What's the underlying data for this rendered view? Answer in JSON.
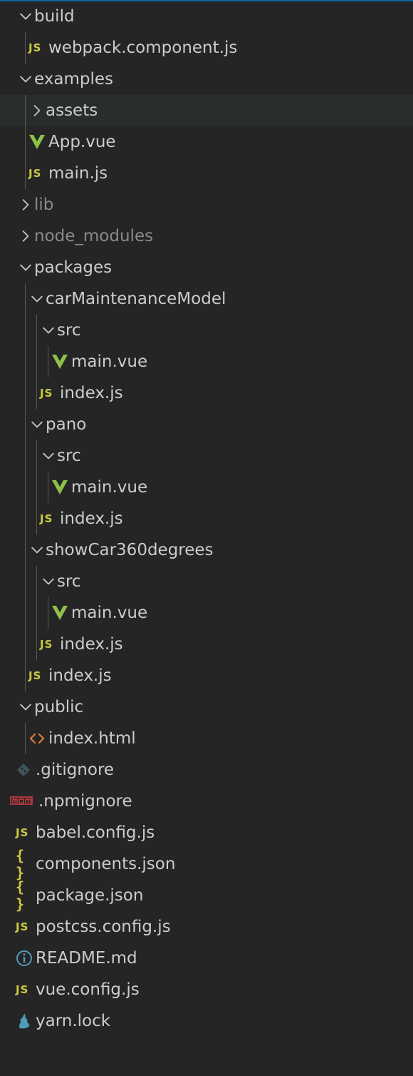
{
  "theme": {
    "background": "#252526",
    "hover_row": "#2a2d2e",
    "text": "#cccccc",
    "dim_text": "#8b8b8b",
    "js_color": "#cbcb41",
    "vue_color": "#8dc149",
    "html_color": "#e37933",
    "git_color": "#41535b",
    "npm_color": "#cc3e44",
    "info_color": "#519aba",
    "yarn_color": "#519aba",
    "indent_guide": "#585858"
  },
  "tree": [
    {
      "label": "build",
      "kind": "folder",
      "expanded": true,
      "depth": 0
    },
    {
      "label": "webpack.component.js",
      "kind": "file",
      "icon": "js-icon",
      "depth": 1
    },
    {
      "label": "examples",
      "kind": "folder",
      "expanded": true,
      "depth": 0
    },
    {
      "label": "assets",
      "kind": "folder",
      "expanded": false,
      "depth": 1,
      "hovered": true
    },
    {
      "label": "App.vue",
      "kind": "file",
      "icon": "vue-icon",
      "depth": 1
    },
    {
      "label": "main.js",
      "kind": "file",
      "icon": "js-icon",
      "depth": 1
    },
    {
      "label": "lib",
      "kind": "folder",
      "expanded": false,
      "depth": 0,
      "dim": true
    },
    {
      "label": "node_modules",
      "kind": "folder",
      "expanded": false,
      "depth": 0,
      "dim": true
    },
    {
      "label": "packages",
      "kind": "folder",
      "expanded": true,
      "depth": 0
    },
    {
      "label": "carMaintenanceModel",
      "kind": "folder",
      "expanded": true,
      "depth": 1
    },
    {
      "label": "src",
      "kind": "folder",
      "expanded": true,
      "depth": 2
    },
    {
      "label": "main.vue",
      "kind": "file",
      "icon": "vue-icon",
      "depth": 3
    },
    {
      "label": "index.js",
      "kind": "file",
      "icon": "js-icon",
      "depth": 2
    },
    {
      "label": "pano",
      "kind": "folder",
      "expanded": true,
      "depth": 1
    },
    {
      "label": "src",
      "kind": "folder",
      "expanded": true,
      "depth": 2
    },
    {
      "label": "main.vue",
      "kind": "file",
      "icon": "vue-icon",
      "depth": 3
    },
    {
      "label": "index.js",
      "kind": "file",
      "icon": "js-icon",
      "depth": 2
    },
    {
      "label": "showCar360degrees",
      "kind": "folder",
      "expanded": true,
      "depth": 1
    },
    {
      "label": "src",
      "kind": "folder",
      "expanded": true,
      "depth": 2
    },
    {
      "label": "main.vue",
      "kind": "file",
      "icon": "vue-icon",
      "depth": 3
    },
    {
      "label": "index.js",
      "kind": "file",
      "icon": "js-icon",
      "depth": 2
    },
    {
      "label": "index.js",
      "kind": "file",
      "icon": "js-icon",
      "depth": 1
    },
    {
      "label": "public",
      "kind": "folder",
      "expanded": true,
      "depth": 0
    },
    {
      "label": "index.html",
      "kind": "file",
      "icon": "html-icon",
      "depth": 1
    },
    {
      "label": ".gitignore",
      "kind": "file",
      "icon": "git-icon",
      "depth": 0
    },
    {
      "label": ".npmignore",
      "kind": "file",
      "icon": "npm-icon",
      "depth": 0
    },
    {
      "label": "babel.config.js",
      "kind": "file",
      "icon": "js-icon",
      "depth": 0
    },
    {
      "label": "components.json",
      "kind": "file",
      "icon": "json-icon",
      "depth": 0
    },
    {
      "label": "package.json",
      "kind": "file",
      "icon": "json-icon",
      "depth": 0
    },
    {
      "label": "postcss.config.js",
      "kind": "file",
      "icon": "js-icon",
      "depth": 0
    },
    {
      "label": "README.md",
      "kind": "file",
      "icon": "info-icon",
      "depth": 0
    },
    {
      "label": "vue.config.js",
      "kind": "file",
      "icon": "js-icon",
      "depth": 0
    },
    {
      "label": "yarn.lock",
      "kind": "file",
      "icon": "yarn-icon",
      "depth": 0
    }
  ],
  "glyphs": {
    "js_text": "JS",
    "json_text": "{ }"
  }
}
